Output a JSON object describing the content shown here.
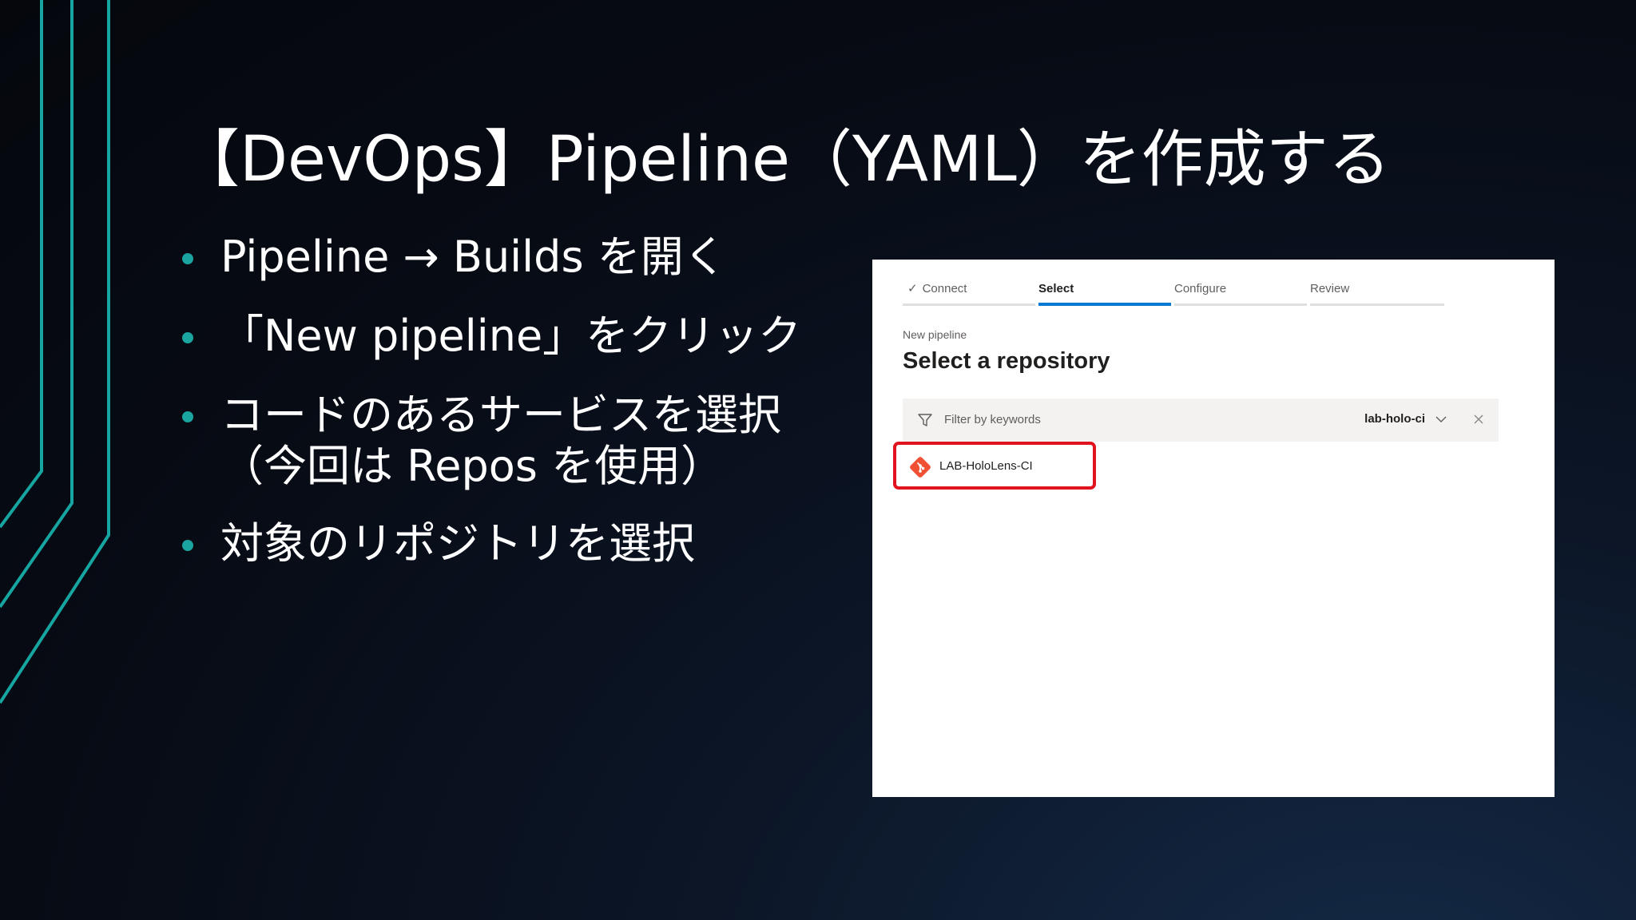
{
  "slide": {
    "title": "【DevOps】Pipeline（YAML）を作成する",
    "bullets": [
      "Pipeline → Builds を開く",
      "「New pipeline」をクリック",
      "コードのあるサービスを選択",
      "（今回は Repos を使用）",
      "対象のリポジトリを選択"
    ]
  },
  "colors": {
    "bullet": "#1ba5a0",
    "accent_line": "#16a5a0",
    "active_tab": "#0078d4",
    "highlight_box": "#e0131e",
    "git_icon": "#f05033"
  },
  "screenshot": {
    "wizard_steps": [
      {
        "label": "Connect",
        "state": "completed",
        "icon": "checkmark-icon"
      },
      {
        "label": "Select",
        "state": "active"
      },
      {
        "label": "Configure",
        "state": "pending"
      },
      {
        "label": "Review",
        "state": "pending"
      }
    ],
    "breadcrumb": "New pipeline",
    "heading": "Select a repository",
    "filter": {
      "placeholder": "Filter by keywords",
      "selected_value": "lab-holo-ci",
      "icons": [
        "funnel-icon",
        "chevron-down-icon",
        "close-icon"
      ]
    },
    "repositories": [
      {
        "name": "LAB-HoloLens-CI",
        "icon": "git-icon",
        "highlighted": true
      }
    ]
  }
}
